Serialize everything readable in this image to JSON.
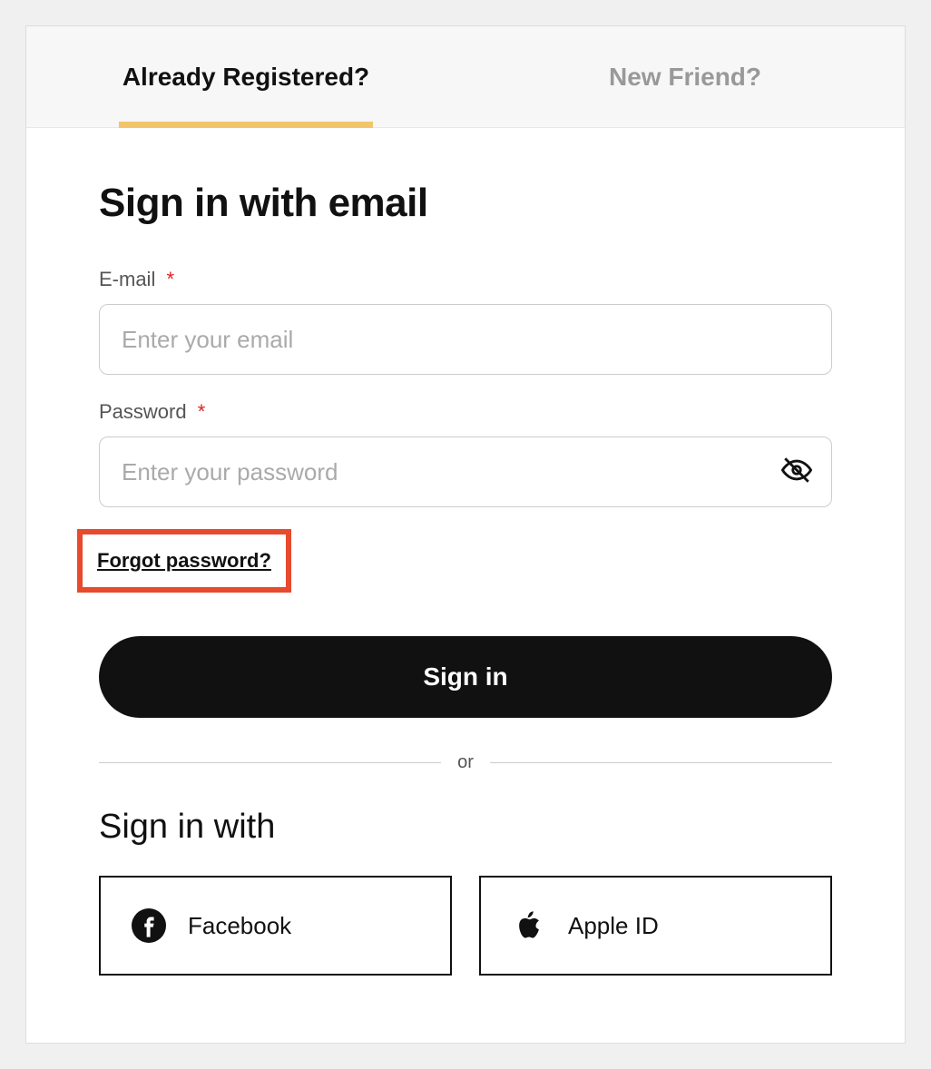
{
  "tabs": {
    "registered": "Already Registered?",
    "new": "New Friend?"
  },
  "heading": "Sign in with email",
  "email": {
    "label": "E-mail",
    "required": "*",
    "placeholder": "Enter your email"
  },
  "password": {
    "label": "Password",
    "required": "*",
    "placeholder": "Enter your password"
  },
  "forgot": "Forgot password?",
  "signin_button": "Sign in",
  "divider": "or",
  "social_heading": "Sign in with",
  "social": {
    "facebook": "Facebook",
    "apple": "Apple ID"
  }
}
